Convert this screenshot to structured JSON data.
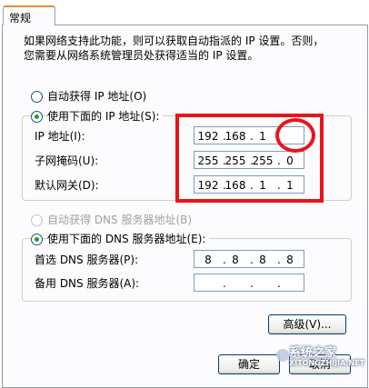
{
  "tab": {
    "label": "常规"
  },
  "description": [
    "如果网络支持此功能，则可以获取自动指派的 IP 设置。否则，",
    "您需要从网络系统管理员处获得适当的 IP 设置。"
  ],
  "ip_section": {
    "auto_radio": "自动获得 IP 地址(O)",
    "manual_radio": "使用下面的 IP 地址(S):",
    "fields": [
      {
        "label": "IP 地址(I):",
        "octets": [
          "192",
          "168",
          "1",
          ""
        ]
      },
      {
        "label": "子网掩码(U):",
        "octets": [
          "255",
          "255",
          "255",
          "0"
        ]
      },
      {
        "label": "默认网关(D):",
        "octets": [
          "192",
          "168",
          "1",
          "1"
        ]
      }
    ]
  },
  "dns_section": {
    "auto_radio": "自动获得 DNS 服务器地址(B)",
    "manual_radio": "使用下面的 DNS 服务器地址(E):",
    "fields": [
      {
        "label": "首选 DNS 服务器(P):",
        "octets": [
          "8",
          "8",
          "8",
          "8"
        ]
      },
      {
        "label": "备用 DNS 服务器(A):",
        "octets": [
          "",
          "",
          "",
          ""
        ]
      }
    ]
  },
  "buttons": {
    "advanced": "高级(V)...",
    "ok": "确定",
    "cancel": "取消"
  },
  "watermark": {
    "line1": "系统之家",
    "line2": "XITONGZHIJIA.NET"
  },
  "colors": {
    "highlight": "#e8141b",
    "radio_dot": "#21a121",
    "tab_accent": "#e68b2c"
  }
}
